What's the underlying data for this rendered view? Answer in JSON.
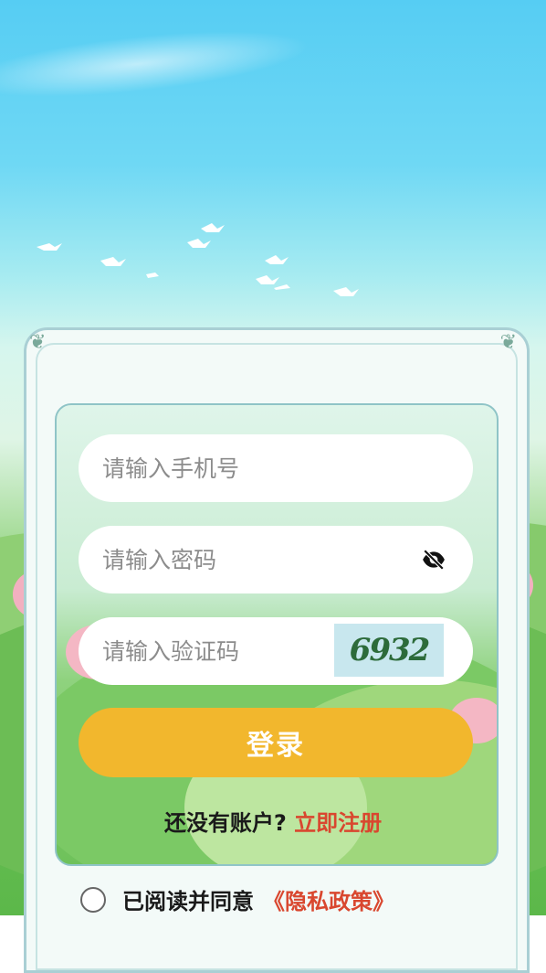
{
  "form": {
    "phone_placeholder": "请输入手机号",
    "password_placeholder": "请输入密码",
    "code_placeholder": "请输入验证码",
    "captcha_text": "6932",
    "login_label": "登录"
  },
  "register": {
    "prompt": "还没有账户?",
    "link": "立即注册"
  },
  "agreement": {
    "text": "已阅读并同意",
    "policy": "《隐私政策》"
  },
  "icons": {
    "eye": "eye-off-icon",
    "radio": "radio-unchecked-icon"
  },
  "colors": {
    "accent": "#f2b72d",
    "link": "#d9472f"
  }
}
